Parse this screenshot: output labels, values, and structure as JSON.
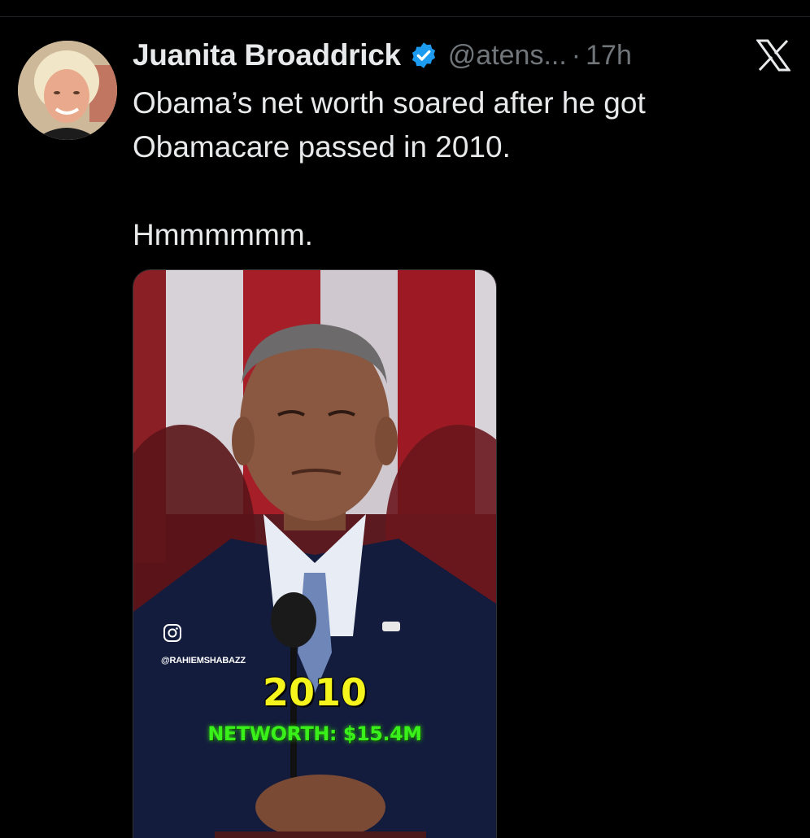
{
  "tweet": {
    "author_name": "Juanita Broaddrick",
    "handle": "@atens...",
    "separator": "·",
    "time": "17h",
    "text_line1": "Obama’s net worth soared after he got",
    "text_line2": "Obamacare passed in 2010.",
    "text_line3": "Hmmmmmm."
  },
  "icons": {
    "verified": "verified-badge-icon",
    "platform_logo": "x-logo-icon",
    "instagram": "instagram-icon"
  },
  "media": {
    "watermark_handle": "@RAHIEMSHABAZZ",
    "overlay_year": "2010",
    "overlay_networth": "NETWORTH: $15.4M"
  },
  "colors": {
    "background": "#000000",
    "primary_text": "#e7e9ea",
    "secondary_text": "#71767b",
    "verified_blue": "#1d9bf0",
    "overlay_year": "#f5f51d",
    "overlay_networth": "#39f01a"
  }
}
